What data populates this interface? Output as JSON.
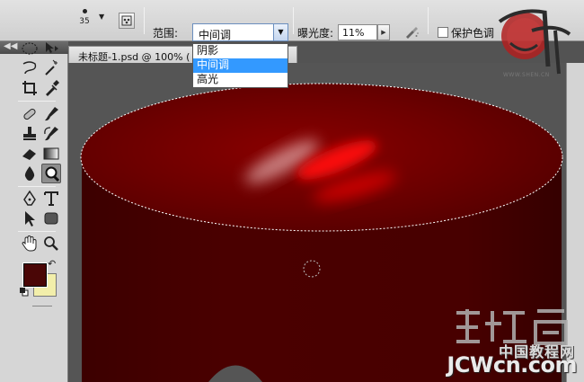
{
  "options_bar": {
    "brush_size": "35",
    "range_label": "范围:",
    "range_value": "中间调",
    "exposure_label": "曝光度:",
    "exposure_value": "11%",
    "protect_tones_label": "保护色调",
    "protect_tones_checked": false
  },
  "range_menu": {
    "items": [
      {
        "label": "阴影",
        "selected": false
      },
      {
        "label": "中间调",
        "selected": true
      },
      {
        "label": "高光",
        "selected": false
      }
    ]
  },
  "document": {
    "tab_title": "未标题-1.psd @ 100% ("
  },
  "colors": {
    "foreground": "#4a0606",
    "background": "#f2eeaa",
    "accent": "#3399ff",
    "canvas_red": "#6b0000"
  },
  "logo": {
    "glyph": "神",
    "site": "WWW.SHEN.CN"
  },
  "watermark": {
    "glyph": "建设营",
    "cn_text": "中国教程网",
    "url": "JCWcn.com"
  }
}
